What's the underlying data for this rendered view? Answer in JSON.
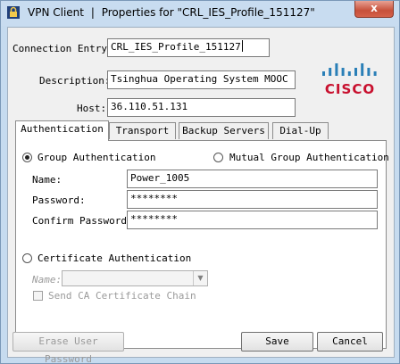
{
  "window": {
    "app_name": "VPN Client",
    "separator": "|",
    "title": "Properties for \"CRL_IES_Profile_151127\"",
    "close_glyph": "x"
  },
  "header": {
    "connection_entry_label": "Connection Entry:",
    "connection_entry_value": "CRL_IES_Profile_151127",
    "description_label": "Description:",
    "description_value": "Tsinghua Operating System MOOC",
    "host_label": "Host:",
    "host_value": "36.110.51.131",
    "logo_text": "CISCO",
    "logo_color": "#c8102e",
    "logo_bar_color": "#2a7fb7"
  },
  "tabs": [
    {
      "label": "Authentication",
      "active": true
    },
    {
      "label": "Transport",
      "active": false
    },
    {
      "label": "Backup Servers",
      "active": false
    },
    {
      "label": "Dial-Up",
      "active": false
    }
  ],
  "auth": {
    "group_auth_label": "Group Authentication",
    "group_auth_selected": true,
    "mutual_auth_label": "Mutual Group Authentication",
    "mutual_auth_selected": false,
    "name_label": "Name:",
    "name_value": "Power_1005",
    "password_label": "Password:",
    "password_value": "********",
    "confirm_label": "Confirm Password:",
    "confirm_value": "********",
    "cert_auth_label": "Certificate Authentication",
    "cert_auth_selected": false,
    "cert_name_label": "Name:",
    "cert_name_value": "",
    "send_ca_label": "Send CA Certificate Chain",
    "send_ca_checked": false
  },
  "buttons": {
    "erase": "Erase User Password",
    "save": "Save",
    "cancel": "Cancel"
  }
}
